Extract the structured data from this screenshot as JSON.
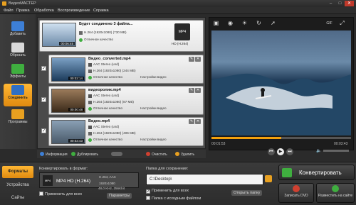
{
  "window": {
    "title": "ВидеоМАСТЕР",
    "minimize": "–",
    "maximize": "□",
    "close": "✕"
  },
  "menu": [
    "Файл",
    "Правка",
    "Обработка",
    "Воспроизведение",
    "Справка"
  ],
  "sidebar": [
    {
      "label": "Добавить",
      "icon": "add-film-icon",
      "color": "#3d7fd6"
    },
    {
      "label": "Обрезать",
      "icon": "cut-icon",
      "color": "#d9d9d9"
    },
    {
      "label": "Эффекты",
      "icon": "effects-icon",
      "color": "#3fae3f"
    },
    {
      "label": "Соединить",
      "icon": "join-icon",
      "color": "#2f6fc4",
      "active": true
    },
    {
      "label": "Программы",
      "icon": "programs-icon",
      "color": "#e8a020"
    }
  ],
  "files": {
    "main": {
      "title": "Будет соединено 3 файла...",
      "format": "H.264 (1920x1080) (730 MB)",
      "quality": "Отличное качество",
      "duration": "00:06:45",
      "target_format": "MP4",
      "target_label": "HD (H.264)"
    },
    "items": [
      {
        "name": "Видео_converted.mp4",
        "audio": "AAC Stereo (und)",
        "video": "H.264 (1920x1080) (244 MB)",
        "quality": "Отличное качество",
        "settings": "Настройки видео",
        "duration": "00:02:14",
        "checked": "✓"
      },
      {
        "name": "видеоролик.mp4",
        "audio": "AAC Stereo (und)",
        "video": "H.264 (1920x1080) (87 MB)",
        "quality": "Отличное качество",
        "settings": "Настройки видео",
        "duration": "00:00:48",
        "checked": "✓"
      },
      {
        "name": "Видео.mp4",
        "audio": "AAC Stereo (und)",
        "video": "H.264 (1920x1080) (406 MB)",
        "quality": "Отличное качество",
        "settings": "Настройки видео",
        "duration": "00:03:43",
        "checked": "✓"
      }
    ]
  },
  "list_tools": {
    "info": "Информация",
    "duplicate": "Дублировать",
    "clear": "Очистить",
    "delete": "Удалить"
  },
  "player": {
    "current": "00:01:53",
    "total": "00:03:43",
    "progress": 0.5
  },
  "bottom": {
    "tabs": [
      "Форматы",
      "Устройства",
      "Сайты"
    ],
    "convert_to_label": "Конвертировать в формат:",
    "format_name": "MP4 HD (H.264)",
    "format_video": "H.264, AAC",
    "format_res": "1920x1080",
    "format_audio": "48,0 KHz, 256Kbit",
    "format_badge": "MP4",
    "apply_all": "Применить для всех",
    "params": "Параметры",
    "save_folder_label": "Папка для сохранения:",
    "save_path": "C:\\Desktop\\",
    "apply_all2": "Применить для всех",
    "source_folder": "Папка с исходным файлом",
    "open_folder": "Открыть папку",
    "convert": "Конвертировать",
    "burn_dvd": "Записать DVD",
    "publish": "Разместить на сайте"
  }
}
